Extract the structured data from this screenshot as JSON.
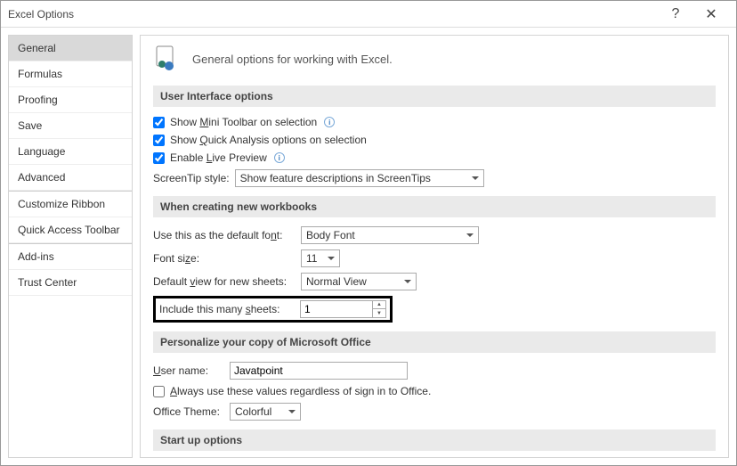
{
  "titlebar": {
    "title": "Excel Options",
    "help_tooltip": "?",
    "close_tooltip": "✕"
  },
  "sidebar": {
    "items": [
      {
        "label": "General"
      },
      {
        "label": "Formulas"
      },
      {
        "label": "Proofing"
      },
      {
        "label": "Save"
      },
      {
        "label": "Language"
      },
      {
        "label": "Advanced"
      },
      {
        "label": "Customize Ribbon"
      },
      {
        "label": "Quick Access Toolbar"
      },
      {
        "label": "Add-ins"
      },
      {
        "label": "Trust Center"
      }
    ]
  },
  "heading": "General options for working with Excel.",
  "sections": {
    "ui_options": {
      "title": "User Interface options",
      "show_mini": "Show Mini Toolbar on selection",
      "show_quick": "Show Quick Analysis options on selection",
      "enable_live": "Enable Live Preview",
      "screentip_label": "ScreenTip style:",
      "screentip_value": "Show feature descriptions in ScreenTips"
    },
    "new_workbooks": {
      "title": "When creating new workbooks",
      "default_font_label": "Use this as the default font:",
      "default_font_value": "Body Font",
      "font_size_label": "Font size:",
      "font_size_value": "11",
      "default_view_label": "Default view for new sheets:",
      "default_view_value": "Normal View",
      "include_sheets_label": "Include this many sheets:",
      "include_sheets_value": "1"
    },
    "personalize": {
      "title": "Personalize your copy of Microsoft Office",
      "username_label": "User name:",
      "username_value": "Javatpoint",
      "always_use_label": "Always use these values regardless of sign in to Office.",
      "theme_label": "Office Theme:",
      "theme_value": "Colorful"
    },
    "startup": {
      "title": "Start up options"
    }
  }
}
